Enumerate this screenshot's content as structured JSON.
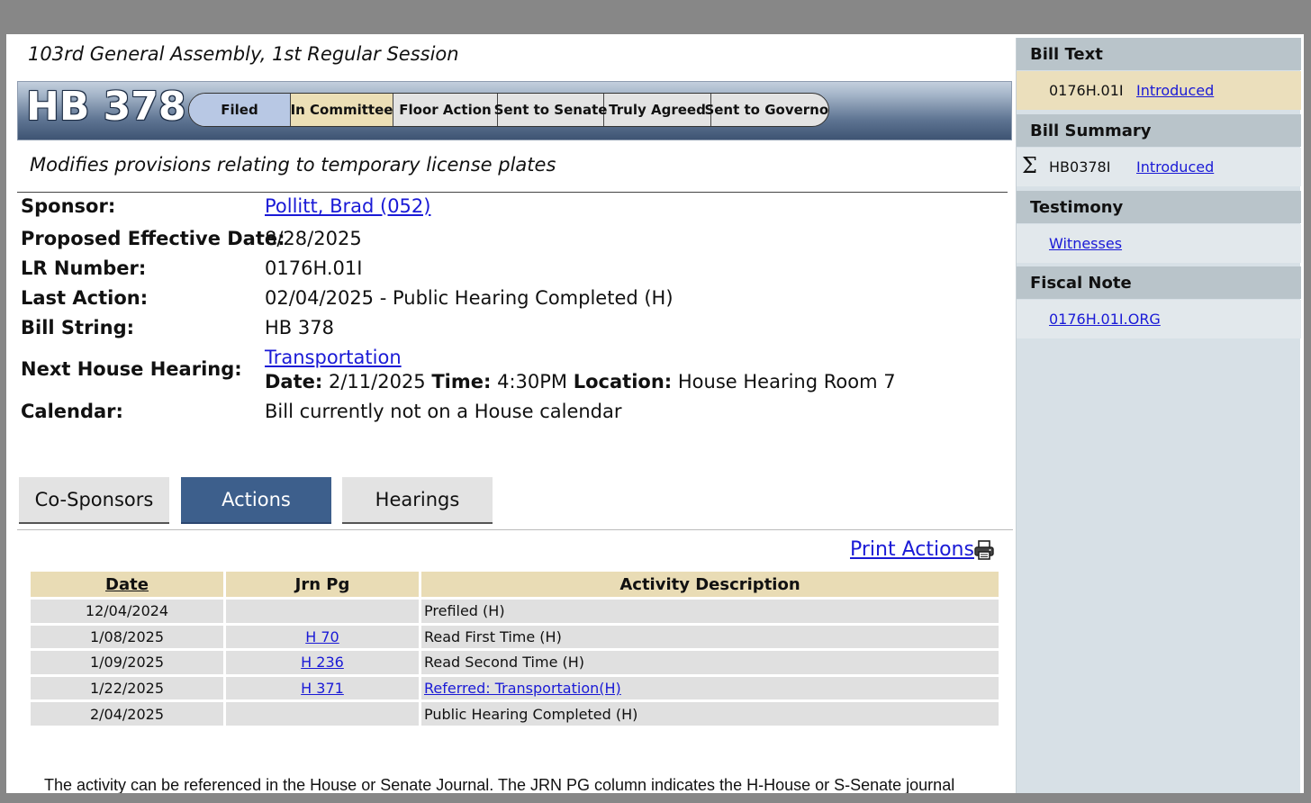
{
  "session": {
    "title": "103rd General Assembly, 1st Regular Session"
  },
  "bill": {
    "number": "HB 378",
    "description": "Modifies provisions relating to temporary license plates"
  },
  "status_steps": [
    "Filed",
    "In Committee",
    "Floor Action",
    "Sent to Senate",
    "Truly Agreed",
    "Sent to Governor"
  ],
  "current_step": "In Committee",
  "info": {
    "sponsor_label": "Sponsor:",
    "sponsor": "Pollitt, Brad (052)",
    "effective_date_label": "Proposed Effective Date:",
    "effective_date": "8/28/2025",
    "lr_label": "LR Number:",
    "lr_number": "0176H.01I",
    "last_action_label": "Last Action:",
    "last_action": "02/04/2025 - Public Hearing Completed (H)",
    "bill_string_label": "Bill String:",
    "bill_string": "HB 378",
    "next_hearing_label": "Next House Hearing:",
    "next_hearing_committee": "Transportation",
    "next_hearing_date_label": "Date:",
    "next_hearing_date": "2/11/2025",
    "next_hearing_time_label": "Time:",
    "next_hearing_time": "4:30PM",
    "next_hearing_location_label": "Location:",
    "next_hearing_location": "House Hearing Room 7",
    "calendar_label": "Calendar:",
    "calendar": "Bill currently not on a House calendar"
  },
  "tabs": [
    "Co-Sponsors",
    "Actions",
    "Hearings"
  ],
  "active_tab": "Actions",
  "print_actions": "Print Actions",
  "actions_table": {
    "headers": [
      "Date",
      "Jrn Pg",
      "Activity Description"
    ],
    "rows": [
      {
        "date": "12/04/2024",
        "jrn": "",
        "desc": "Prefiled (H)"
      },
      {
        "date": "1/08/2025",
        "jrn": "H 70",
        "desc": "Read First Time (H)"
      },
      {
        "date": "1/09/2025",
        "jrn": "H 236",
        "desc": "Read Second Time (H)"
      },
      {
        "date": "1/22/2025",
        "jrn": "H 371",
        "desc": "Referred: Transportation(H)"
      },
      {
        "date": "2/04/2025",
        "jrn": "",
        "desc": "Public Hearing Completed (H)"
      }
    ]
  },
  "footnote": "The activity can be referenced in the House or Senate Journal. The JRN PG column indicates the H-House or S-Senate journal",
  "sidebar": {
    "bill_text_heading": "Bill Text",
    "bill_text_id": "0176H.01I",
    "bill_text_link": "Introduced",
    "bill_summary_heading": "Bill Summary",
    "bill_summary_id": "HB0378I",
    "bill_summary_link": "Introduced",
    "testimony_heading": "Testimony",
    "testimony_link": "Witnesses",
    "fiscal_note_heading": "Fiscal Note",
    "fiscal_note_link": "0176H.01I.ORG"
  },
  "colors": {
    "active_tab": "#3d5f8c",
    "table_header": "#e9dcb5",
    "link": "#1a1ad6"
  }
}
